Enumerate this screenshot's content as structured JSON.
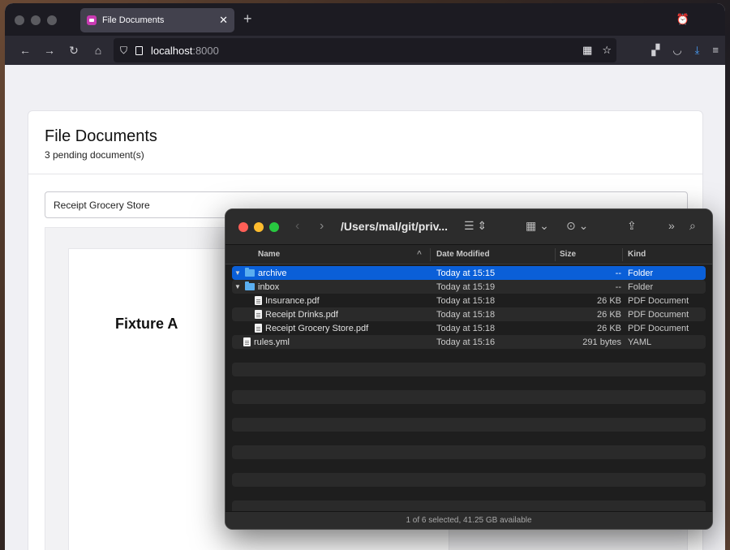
{
  "browser": {
    "tab": {
      "title": "File Documents",
      "close": "✕"
    },
    "new_tab": "+",
    "url": {
      "host": "localhost",
      "port": ":8000"
    }
  },
  "page": {
    "title": "File Documents",
    "subtitle": "3 pending document(s)",
    "search_value": "Receipt Grocery Store",
    "preview_label": "Fixture A"
  },
  "finder": {
    "path": "/Users/mal/git/priv...",
    "columns": {
      "name": "Name",
      "date": "Date Modified",
      "size": "Size",
      "kind": "Kind"
    },
    "rows": [
      {
        "name": "archive",
        "date": "Today at 15:15",
        "size": "--",
        "kind": "Folder"
      },
      {
        "name": "inbox",
        "date": "Today at 15:19",
        "size": "--",
        "kind": "Folder"
      },
      {
        "name": "Insurance.pdf",
        "date": "Today at 15:18",
        "size": "26 KB",
        "kind": "PDF Document"
      },
      {
        "name": "Receipt Drinks.pdf",
        "date": "Today at 15:18",
        "size": "26 KB",
        "kind": "PDF Document"
      },
      {
        "name": "Receipt Grocery Store.pdf",
        "date": "Today at 15:18",
        "size": "26 KB",
        "kind": "PDF Document"
      },
      {
        "name": "rules.yml",
        "date": "Today at 15:16",
        "size": "291 bytes",
        "kind": "YAML"
      }
    ],
    "status": "1 of 6 selected, 41.25 GB available"
  }
}
